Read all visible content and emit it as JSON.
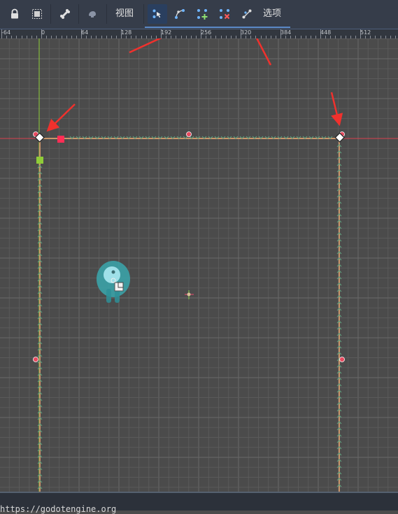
{
  "toolbar": {
    "view_label": "视图",
    "options_label": "选项",
    "buttons": [
      {
        "name": "lock",
        "icon": "lock-icon"
      },
      {
        "name": "group",
        "icon": "group-select-icon"
      },
      {
        "name": "bone",
        "icon": "bone-icon"
      },
      {
        "name": "skeleton",
        "icon": "skeleton-icon"
      },
      {
        "name": "edit-points",
        "icon": "select-points-icon",
        "active": true
      },
      {
        "name": "edit-curve",
        "icon": "edit-curve-icon"
      },
      {
        "name": "add-point",
        "icon": "add-point-icon"
      },
      {
        "name": "delete-point",
        "icon": "delete-point-icon"
      },
      {
        "name": "close-curve",
        "icon": "close-curve-icon"
      }
    ]
  },
  "ruler": {
    "labels": [
      "-64",
      "0",
      "64",
      "128",
      "192",
      "256",
      "320",
      "384",
      "448",
      "512"
    ]
  },
  "status": {
    "text": "https://godotengine.org"
  },
  "colors": {
    "toolbar_bg": "#363d4a",
    "canvas_bg": "#4b4b4b",
    "grid": "#5e5e5e",
    "x_axis": "#d9404f",
    "y_axis": "#8fcc38",
    "wall": "#c8956a",
    "collision_arrows": "#5f9f7e",
    "control_point": "#e84a5f",
    "selected_handle": "#ff2d55",
    "anchor": "#8fcc38",
    "annotation_arrow": "#f0312d"
  }
}
